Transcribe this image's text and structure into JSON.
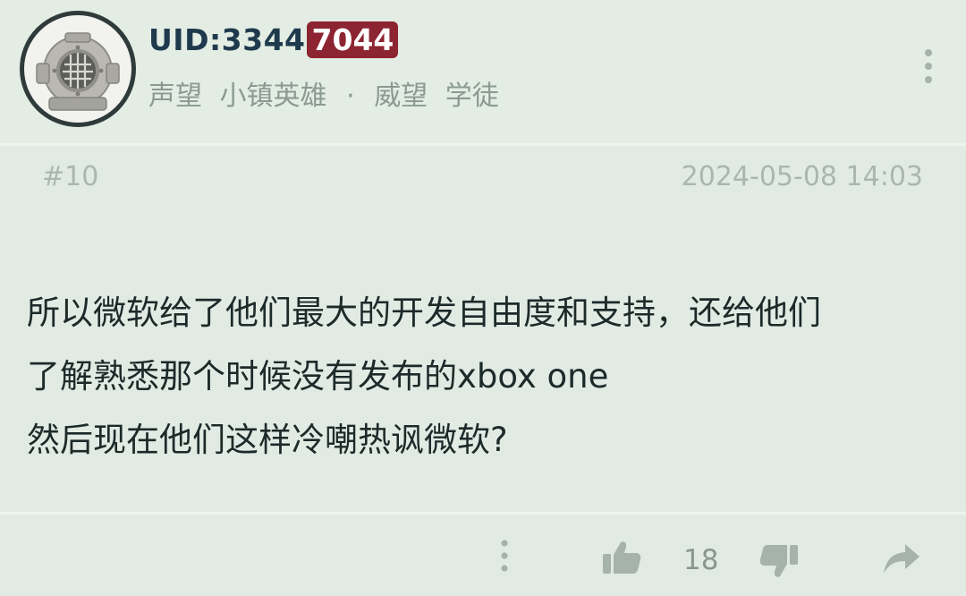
{
  "user": {
    "uid_prefix": "UID:3344",
    "uid_highlight": "7044",
    "rank_label": "声望",
    "rank_value": "小镇英雄",
    "separator": "·",
    "prestige_label": "威望",
    "prestige_value": "学徒",
    "avatar_icon": "diving-helmet-icon"
  },
  "post": {
    "number": "#10",
    "timestamp": "2024-05-08 14:03",
    "lines": [
      "所以微软给了他们最大的开发自由度和支持，还给他们",
      "了解熟悉那个时候没有发布的xbox one",
      "然后现在他们这样冷嘲热讽微软?"
    ]
  },
  "actions": {
    "like_count": "18",
    "more_icon": "more-vertical-icon",
    "like_icon": "thumbs-up-icon",
    "dislike_icon": "thumbs-down-icon",
    "share_icon": "share-icon"
  },
  "colors": {
    "background": "#e2ebe3",
    "uid_text": "#1f3a4d",
    "uid_badge": "#8c2431",
    "muted_text": "#8b9a93",
    "body_text": "#1c2a2a"
  }
}
